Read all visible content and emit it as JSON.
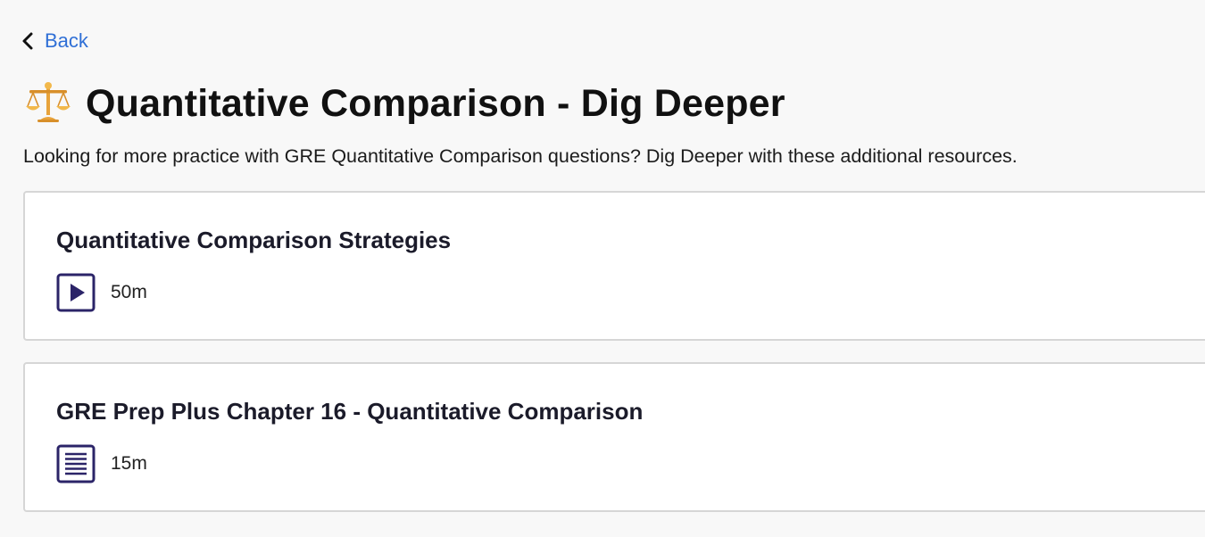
{
  "nav": {
    "back_label": "Back",
    "back_icon": "chevron-left-icon",
    "link_color": "#2f6fd6"
  },
  "header": {
    "icon": "scales-icon",
    "title": "Quantitative Comparison - Dig Deeper",
    "description": "Looking for more practice with GRE Quantitative Comparison questions? Dig Deeper with these additional resources."
  },
  "resources": [
    {
      "title": "Quantitative Comparison Strategies",
      "type_icon": "video-play-icon",
      "duration": "50m"
    },
    {
      "title": "GRE Prep Plus Chapter 16 - Quantitative Comparison",
      "type_icon": "document-icon",
      "duration": "15m"
    }
  ],
  "colors": {
    "icon_accent": "#2b2468",
    "title_icon_gold": "#e8a33b"
  }
}
